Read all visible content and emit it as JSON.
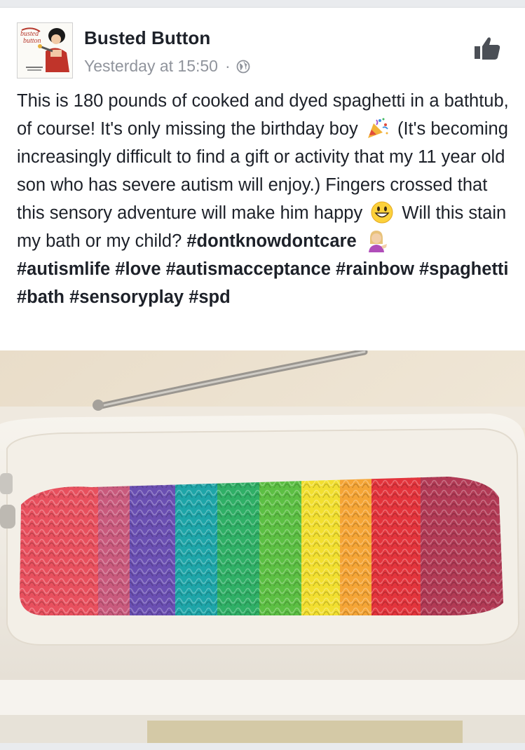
{
  "post": {
    "author": "Busted Button",
    "timestamp": "Yesterday at 15:50",
    "separator": "·",
    "privacy_icon": "globe-icon",
    "avatar_text": "busted button",
    "text_parts": {
      "a": "This is 180 pounds of cooked and dyed spaghetti in a bathtub, of course! It's only missing the birthday boy",
      "b": "(It's becoming increasingly difficult to find a gift or activity that my 11 year old son who has severe autism will enjoy.) Fingers crossed that this sensory adventure will make him happy",
      "c": "Will this stain my bath or my child?",
      "tag1": "#dontknowdontcare",
      "tag2": "#autismlife #love #autismacceptance #rainbow #spaghetti #bath #sensoryplay #spd"
    },
    "emojis": [
      "party-popper-icon",
      "grinning-face-icon",
      "woman-tipping-hand-icon"
    ],
    "photo_description_icon": "rainbow-spaghetti-bathtub-photo"
  },
  "colors": {
    "text": "#1d2129",
    "meta": "#90949c",
    "divider": "#e9ebee",
    "stripes": [
      "#e8505e",
      "#c95a7d",
      "#6a4fb2",
      "#1ea5a8",
      "#2faf66",
      "#5cbf43",
      "#f2df30",
      "#f5a536",
      "#e3343c",
      "#b23a55"
    ]
  }
}
